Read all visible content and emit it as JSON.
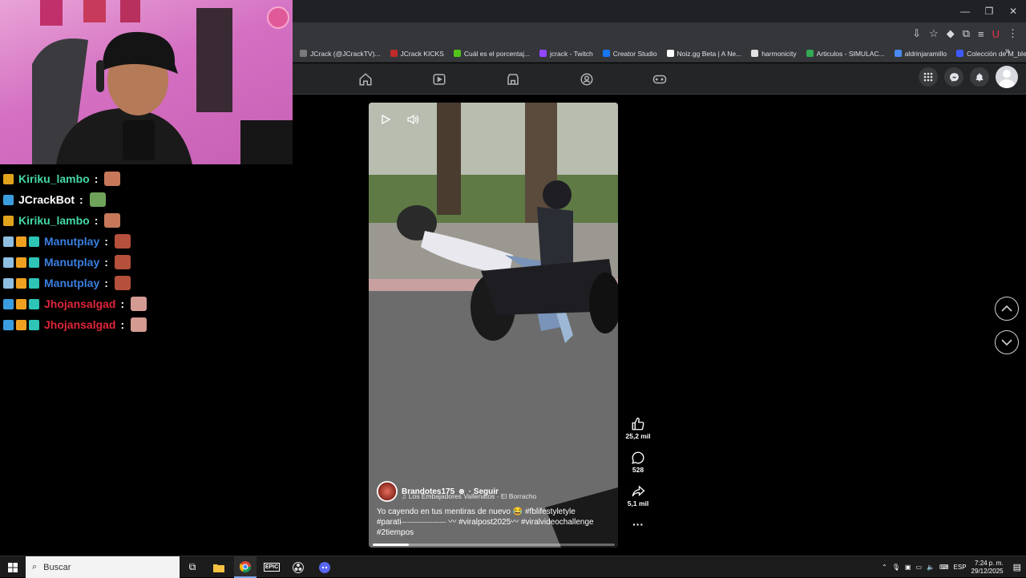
{
  "browser": {
    "bookmarks": [
      {
        "label": "JCrack (@JCrackTV)...",
        "color": "#7a7a7a"
      },
      {
        "label": "JCrack KICKS",
        "color": "#c02a2a"
      },
      {
        "label": "Cuál es el porcentaj...",
        "color": "#52c41a"
      },
      {
        "label": "jcrack - Twitch",
        "color": "#9146ff"
      },
      {
        "label": "Creator Studio",
        "color": "#1877f2"
      },
      {
        "label": "Noiz.gg Beta | A Ne...",
        "color": "#ffffff"
      },
      {
        "label": "harmonicity",
        "color": "#e0e0e0"
      },
      {
        "label": "Articulos - SIMULAC...",
        "color": "#34a853"
      },
      {
        "label": "aldrinjaramillo",
        "color": "#4a8af4"
      },
      {
        "label": "Colección de M_blei...",
        "color": "#3d5afe"
      }
    ],
    "more_label": "»",
    "window_controls": [
      "—",
      "❐",
      "✕"
    ]
  },
  "chat": [
    {
      "user": "Kiriku_lambo",
      "color": "#43d9a8",
      "badges": [
        "#e0a31b"
      ],
      "emote": "#c8785a"
    },
    {
      "user": "JCrackBot",
      "color": "#ffffff",
      "badges": [
        "#3b9ddf"
      ],
      "emote": "#6fa35a"
    },
    {
      "user": "Kiriku_lambo",
      "color": "#43d9a8",
      "badges": [
        "#e0a31b"
      ],
      "emote": "#c8785a"
    },
    {
      "user": "Manutplay",
      "color": "#3a7fe0",
      "badges": [
        "#8fbfe0",
        "#f0a020",
        "#2ec4b6"
      ],
      "emote": "#b5503c"
    },
    {
      "user": "Manutplay",
      "color": "#3a7fe0",
      "badges": [
        "#8fbfe0",
        "#f0a020",
        "#2ec4b6"
      ],
      "emote": "#b5503c"
    },
    {
      "user": "Manutplay",
      "color": "#3a7fe0",
      "badges": [
        "#8fbfe0",
        "#f0a020",
        "#2ec4b6"
      ],
      "emote": "#b5503c"
    },
    {
      "user": "Jhojansalgad",
      "color": "#e0253a",
      "badges": [
        "#3b9ddf",
        "#f0a020",
        "#2ec4b6"
      ],
      "emote": "#d49b93"
    },
    {
      "user": "Jhojansalgad",
      "color": "#e0253a",
      "badges": [
        "#3b9ddf",
        "#f0a020",
        "#2ec4b6"
      ],
      "emote": "#d49b93"
    }
  ],
  "chat_separator": ":",
  "reel": {
    "author": "Brandotes175",
    "follow": "· Seguir",
    "music": "♫ Los Embajadores Vallenatos · El Borracho",
    "description": "Yo cayendo en tus mentiras de nuevo 😂 #fblifestyletyle #parati⏤⏤⏤⏤⏤⏤⏤ 〰 #viralpost2025〰 #viralvideochallenge #2tiempos",
    "progress": 0.15,
    "likes": "25,2 mil",
    "comments": "528",
    "shares": "5,1 mil",
    "more": "···"
  },
  "taskbar": {
    "search_placeholder": "Buscar",
    "lang": "ESP",
    "time": "7:24 p. m.",
    "date": "29/12/2025"
  }
}
